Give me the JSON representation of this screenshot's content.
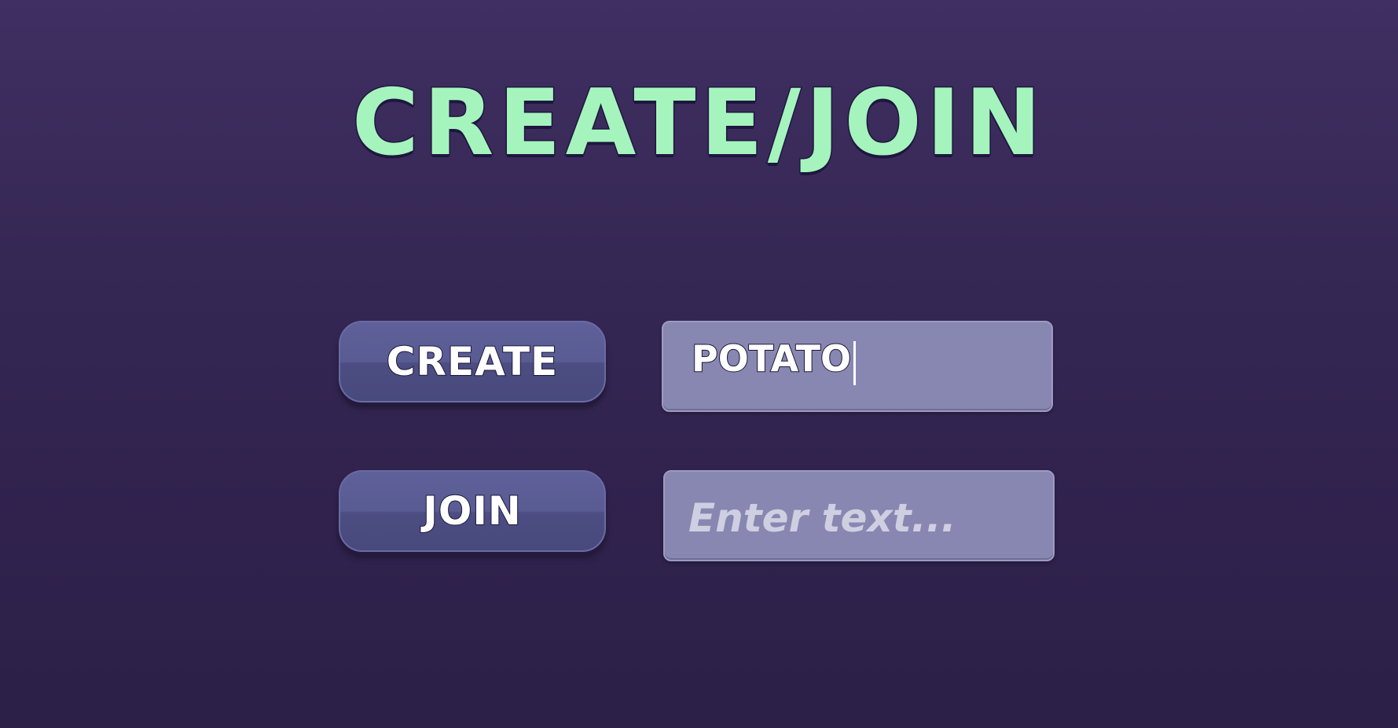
{
  "title": "Create/Join",
  "create": {
    "button_label": "CREATE",
    "input_value": "POTATO"
  },
  "join": {
    "button_label": "JOIN",
    "input_value": "",
    "input_placeholder": "Enter text..."
  },
  "colors": {
    "title": "#a6f4bd",
    "background": "#30224d",
    "button": "#595b93",
    "field": "#8887b1"
  }
}
